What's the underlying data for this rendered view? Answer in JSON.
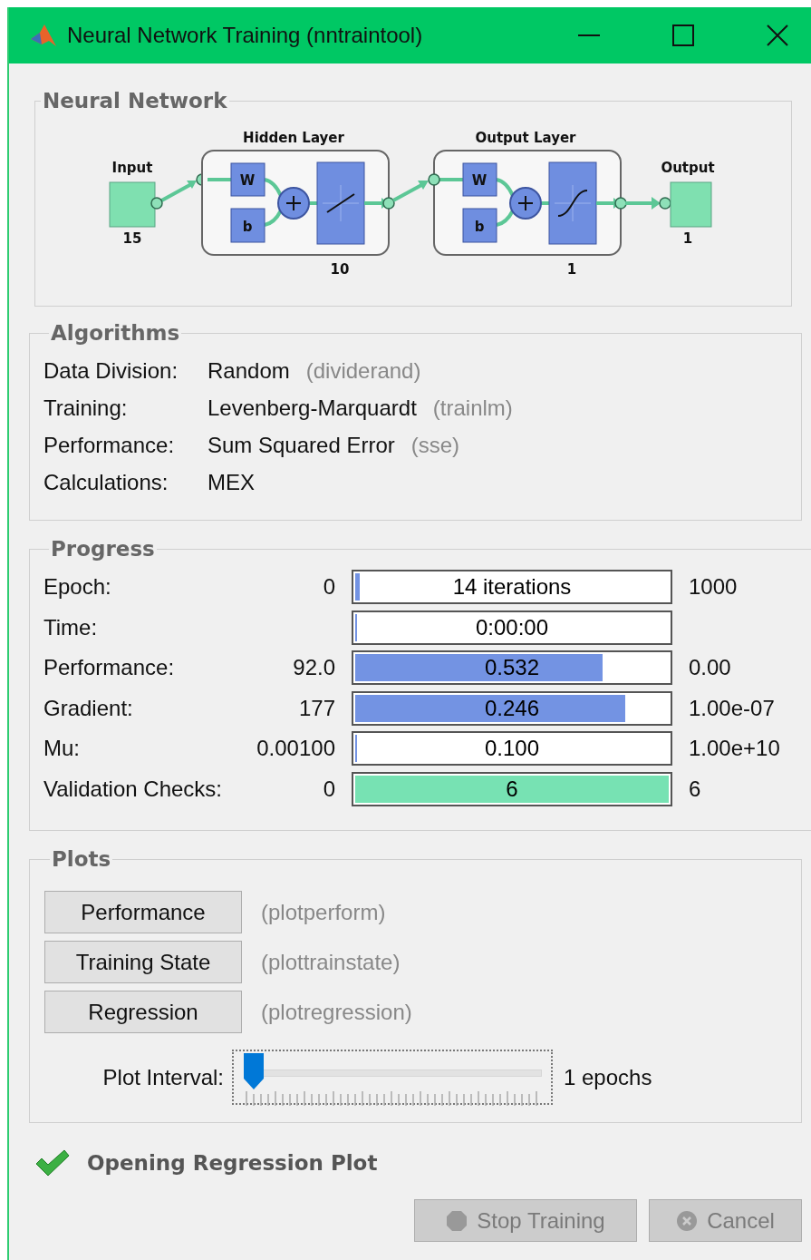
{
  "window": {
    "title": "Neural Network Training (nntraintool)"
  },
  "network": {
    "legend": "Neural Network",
    "input": {
      "label": "Input",
      "size": "15"
    },
    "layers": [
      {
        "title": "Hidden Layer",
        "weight": "W",
        "bias": "b",
        "size": "10",
        "kind": "linear"
      },
      {
        "title": "Output Layer",
        "weight": "W",
        "bias": "b",
        "size": "1",
        "kind": "sigmoid"
      }
    ],
    "output": {
      "label": "Output",
      "size": "1"
    }
  },
  "algorithms": {
    "legend": "Algorithms",
    "rows": [
      {
        "label": "Data Division:",
        "value": "Random",
        "hint": "(dividerand)"
      },
      {
        "label": "Training:",
        "value": "Levenberg-Marquardt",
        "hint": "(trainlm)"
      },
      {
        "label": "Performance:",
        "value": "Sum Squared Error",
        "hint": "(sse)"
      },
      {
        "label": "Calculations:",
        "value": "MEX"
      }
    ]
  },
  "progress": {
    "legend": "Progress",
    "rows": [
      {
        "label": "Epoch:",
        "start": "0",
        "text": "14 iterations",
        "end": "1000",
        "level": 0.014,
        "color": "#7393e3"
      },
      {
        "label": "Time:",
        "text": "0:00:00",
        "level": 0,
        "color": "#7393e3"
      },
      {
        "label": "Performance:",
        "start": "92.0",
        "text": "0.532",
        "end": "0.00",
        "level": 0.78,
        "color": "#7393e3"
      },
      {
        "label": "Gradient:",
        "start": "177",
        "text": "0.246",
        "end": "1.00e-07",
        "level": 0.85,
        "color": "#7393e3"
      },
      {
        "label": "Mu:",
        "start": "0.00100",
        "text": "0.100",
        "end": "1.00e+10",
        "level": 0,
        "color": "#7393e3"
      },
      {
        "label": "Validation Checks:",
        "start": "0",
        "text": "6",
        "end": "6",
        "level": 1,
        "color": "#77e2b3"
      }
    ]
  },
  "plots": {
    "legend": "Plots",
    "buttons": [
      {
        "label": "Performance",
        "hint": "(plotperform)"
      },
      {
        "label": "Training State",
        "hint": "(plottrainstate)"
      },
      {
        "label": "Regression",
        "hint": "(plotregression)"
      }
    ],
    "interval": {
      "label": "Plot Interval:",
      "level": 0,
      "value": "1 epochs"
    }
  },
  "status": {
    "text": "Opening Regression Plot"
  },
  "buttons": [
    {
      "label": "Stop Training",
      "kind": "stop",
      "disabled": true
    },
    {
      "label": "Cancel",
      "kind": "cancel",
      "disabled": true
    }
  ]
}
